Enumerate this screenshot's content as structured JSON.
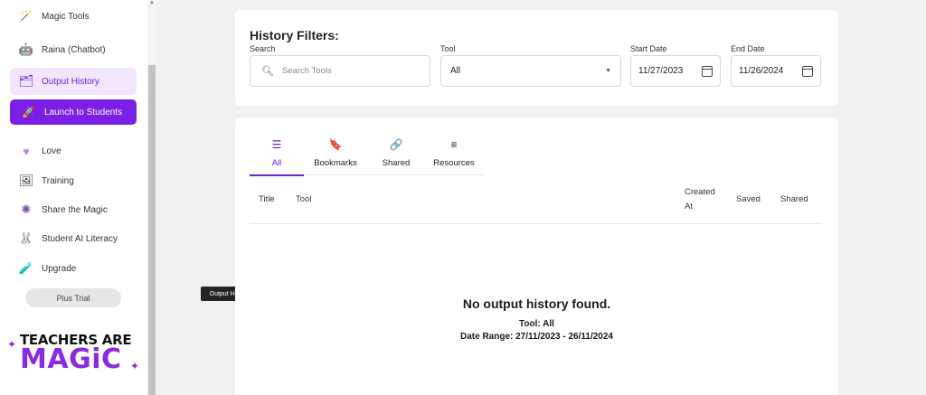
{
  "sidebar": {
    "items": [
      {
        "label": "Magic Tools",
        "icon": "wand-tools-icon"
      },
      {
        "label": "Raina (Chatbot)",
        "icon": "robot-icon"
      },
      {
        "label": "Output History",
        "icon": "folder-history-icon"
      },
      {
        "label": "Love",
        "icon": "heart-icon"
      },
      {
        "label": "Training",
        "icon": "easel-icon"
      },
      {
        "label": "Share the Magic",
        "icon": "sparkle-share-icon"
      },
      {
        "label": "Student AI Literacy",
        "icon": "bunny-icon"
      },
      {
        "label": "Upgrade",
        "icon": "potion-icon"
      }
    ],
    "launch_label": "Launch to Students",
    "plus_trial": "Plus Trial",
    "logo": {
      "line1": "TEACHERS ARE",
      "line2": "MAGiC"
    }
  },
  "tooltip": "Output History",
  "filters": {
    "title": "History Filters:",
    "search_label": "Search",
    "search_placeholder": "Search Tools",
    "tool_label": "Tool",
    "tool_value": "All",
    "start_label": "Start Date",
    "start_value": "11/27/2023",
    "end_label": "End Date",
    "end_value": "11/26/2024"
  },
  "tabs": [
    {
      "label": "All",
      "icon": "list-icon"
    },
    {
      "label": "Bookmarks",
      "icon": "bookmark-icon"
    },
    {
      "label": "Shared",
      "icon": "link-icon"
    },
    {
      "label": "Resources",
      "icon": "lines-icon"
    }
  ],
  "table": {
    "title": "Title",
    "tool": "Tool",
    "created_1": "Created",
    "created_2": "At",
    "saved": "Saved",
    "shared": "Shared"
  },
  "empty": {
    "title": "No output history found.",
    "tool_line": "Tool: All",
    "range_line": "Date Range: 27/11/2023 - 26/11/2024"
  },
  "colors": {
    "accent": "#7c1fe6",
    "active_bg": "#f1e6fd",
    "page_bg": "#f1f1f3"
  }
}
